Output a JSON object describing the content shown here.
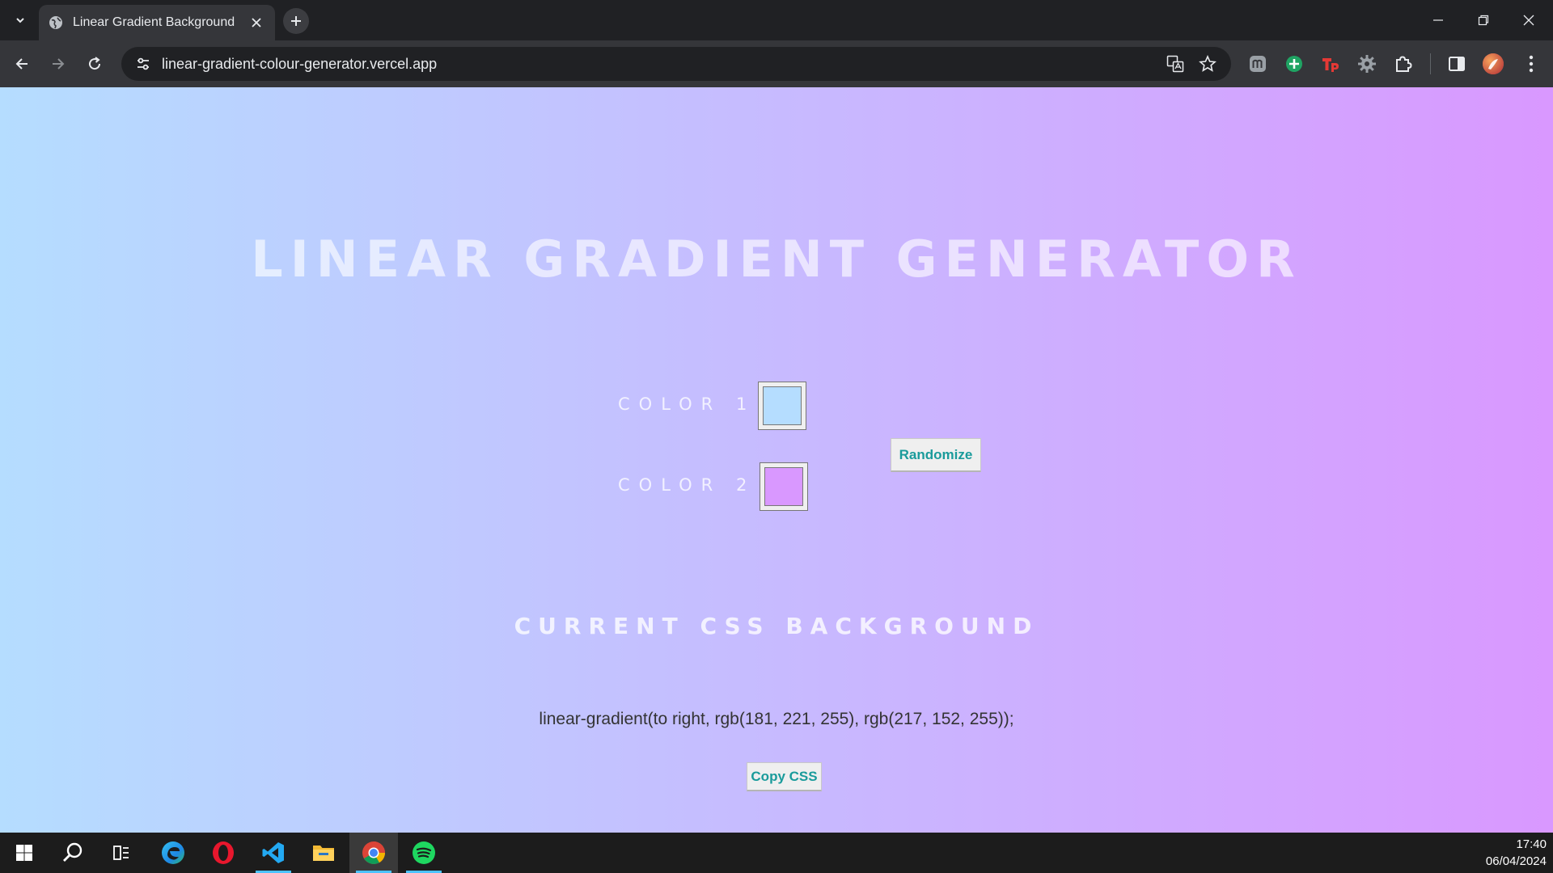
{
  "browser": {
    "tab": {
      "title": "Linear Gradient Background",
      "favicon": "globe-icon"
    },
    "address_bar": {
      "url": "linear-gradient-colour-generator.vercel.app"
    },
    "extensions": [
      "m-extension-icon",
      "green-plus-extension-icon",
      "tp-extension-icon",
      "gear-extension-icon",
      "puzzle-extensions-icon"
    ],
    "colors": {
      "chrome_dark": "#202124",
      "chrome_mid": "#35363a"
    }
  },
  "page": {
    "title": "LINEAR GRADIENT GENERATOR",
    "color1_label": "COLOR 1",
    "color2_label": "COLOR 2",
    "color1_value": "#b5ddff",
    "color2_value": "#d998ff",
    "randomize_label": "Randomize",
    "section_heading": "CURRENT CSS BACKGROUND",
    "css_output": "linear-gradient(to right, rgb(181, 221, 255), rgb(217, 152, 255));",
    "copy_label": "Copy CSS",
    "button_text_color": "#1a9b9b"
  },
  "taskbar": {
    "apps": [
      "windows-start-icon",
      "search-icon",
      "task-view-icon",
      "edge-icon",
      "opera-icon",
      "vscode-icon",
      "file-explorer-icon",
      "chrome-icon",
      "spotify-icon"
    ],
    "time": "17:40",
    "date": "06/04/2024"
  }
}
